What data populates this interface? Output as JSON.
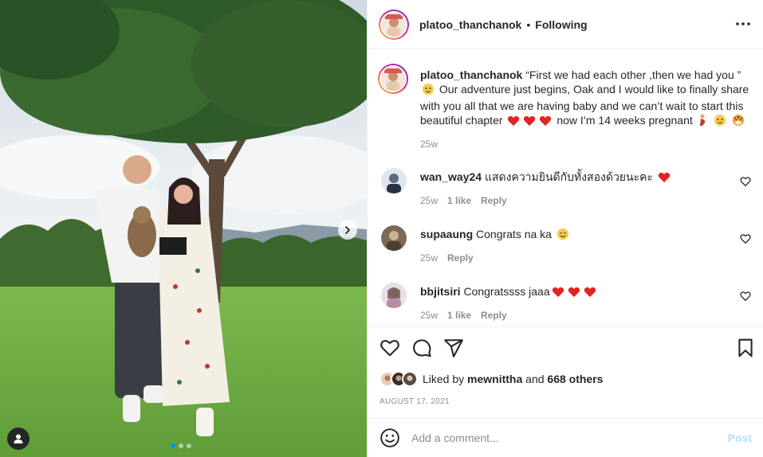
{
  "header": {
    "username": "platoo_thanchanok",
    "separator": "•",
    "follow_label": "Following",
    "more_icon": "more-horizontal-icon"
  },
  "caption": {
    "username": "platoo_thanchanok",
    "text_1": "“First we had each other ,then we had you ”",
    "text_2": "Our adventure just begins, Oak and I would like to finally share with you all that we are having baby and we can’t wait to start this beautiful chapter",
    "text_3": "now I’m 14 weeks pregnant",
    "time": "25w"
  },
  "comments": [
    {
      "username": "wan_way24",
      "text": "แสดงความยินดีกับทั้งสองด้วยนะคะ",
      "time": "25w",
      "likes": "1 like",
      "reply": "Reply"
    },
    {
      "username": "supaaung",
      "text": "Congrats na ka",
      "time": "25w",
      "likes": "",
      "reply": "Reply"
    },
    {
      "username": "bbjitsiri",
      "text": "Congratssss jaaa",
      "time": "25w",
      "likes": "1 like",
      "reply": "Reply"
    }
  ],
  "actions": {
    "liked_by_prefix": "Liked by",
    "liked_by_user": "mewnittha",
    "liked_by_and": "and",
    "liked_by_others": "668 others",
    "date": "AUGUST 17, 2021"
  },
  "add_comment": {
    "placeholder": "Add a comment...",
    "post_label": "Post"
  },
  "carousel": {
    "slides": 3,
    "active_index": 0
  },
  "colors": {
    "text": "#262626",
    "muted": "#8e8e8e",
    "border": "#efefef",
    "link_blue": "#0095f6",
    "post_disabled": "#b2dffc",
    "heart_red": "#ed4956"
  }
}
